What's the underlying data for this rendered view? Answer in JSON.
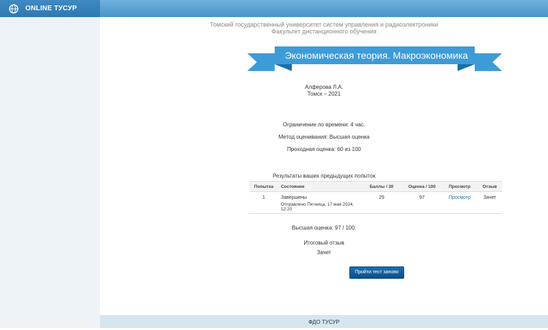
{
  "brand": {
    "label": "ONLINE ТУСУР",
    "logo_icon": "globe-logo-icon"
  },
  "header": {
    "university": "Томский государственный университет систем управления и радиоэлектроники",
    "faculty": "Факультет дистанционного обучения"
  },
  "course": {
    "title": "Экономическая теория. Макроэкономика",
    "author": "Алферова Л.А.",
    "city_year": "Томск – 2021"
  },
  "quiz_info": {
    "time_limit": "Ограничение по времени: 4 час.",
    "grading_method": "Метод оценивания: Высшая оценка",
    "passing_grade": "Проходная оценка: 60 из 100"
  },
  "attempts": {
    "caption": "Результаты ваших предыдущих попыток",
    "columns": {
      "attempt": "Попытка",
      "state": "Состояние",
      "points": "Баллы / 30",
      "grade": "Оценка / 100",
      "review": "Просмотр",
      "feedback": "Отзыв"
    },
    "rows": [
      {
        "attempt": "1",
        "state": "Завершены",
        "submitted": "Отправлено Пятница, 17 мая 2024, 12:20",
        "points": "29",
        "grade": "97",
        "review": "Просмотр",
        "feedback": "Зачет"
      }
    ]
  },
  "summary": {
    "highest_grade": "Высшая оценка: 97 / 100.",
    "overall_feedback_label": "Итоговый отзыв",
    "overall_feedback_value": "Зачет"
  },
  "actions": {
    "retake": "Пройти тест заново"
  },
  "footer": {
    "text": "ФДО ТУСУР"
  },
  "colors": {
    "ribbon": "#3d9bd8",
    "ribbon_dark": "#1b6ea8",
    "button": "#0b4f86"
  }
}
